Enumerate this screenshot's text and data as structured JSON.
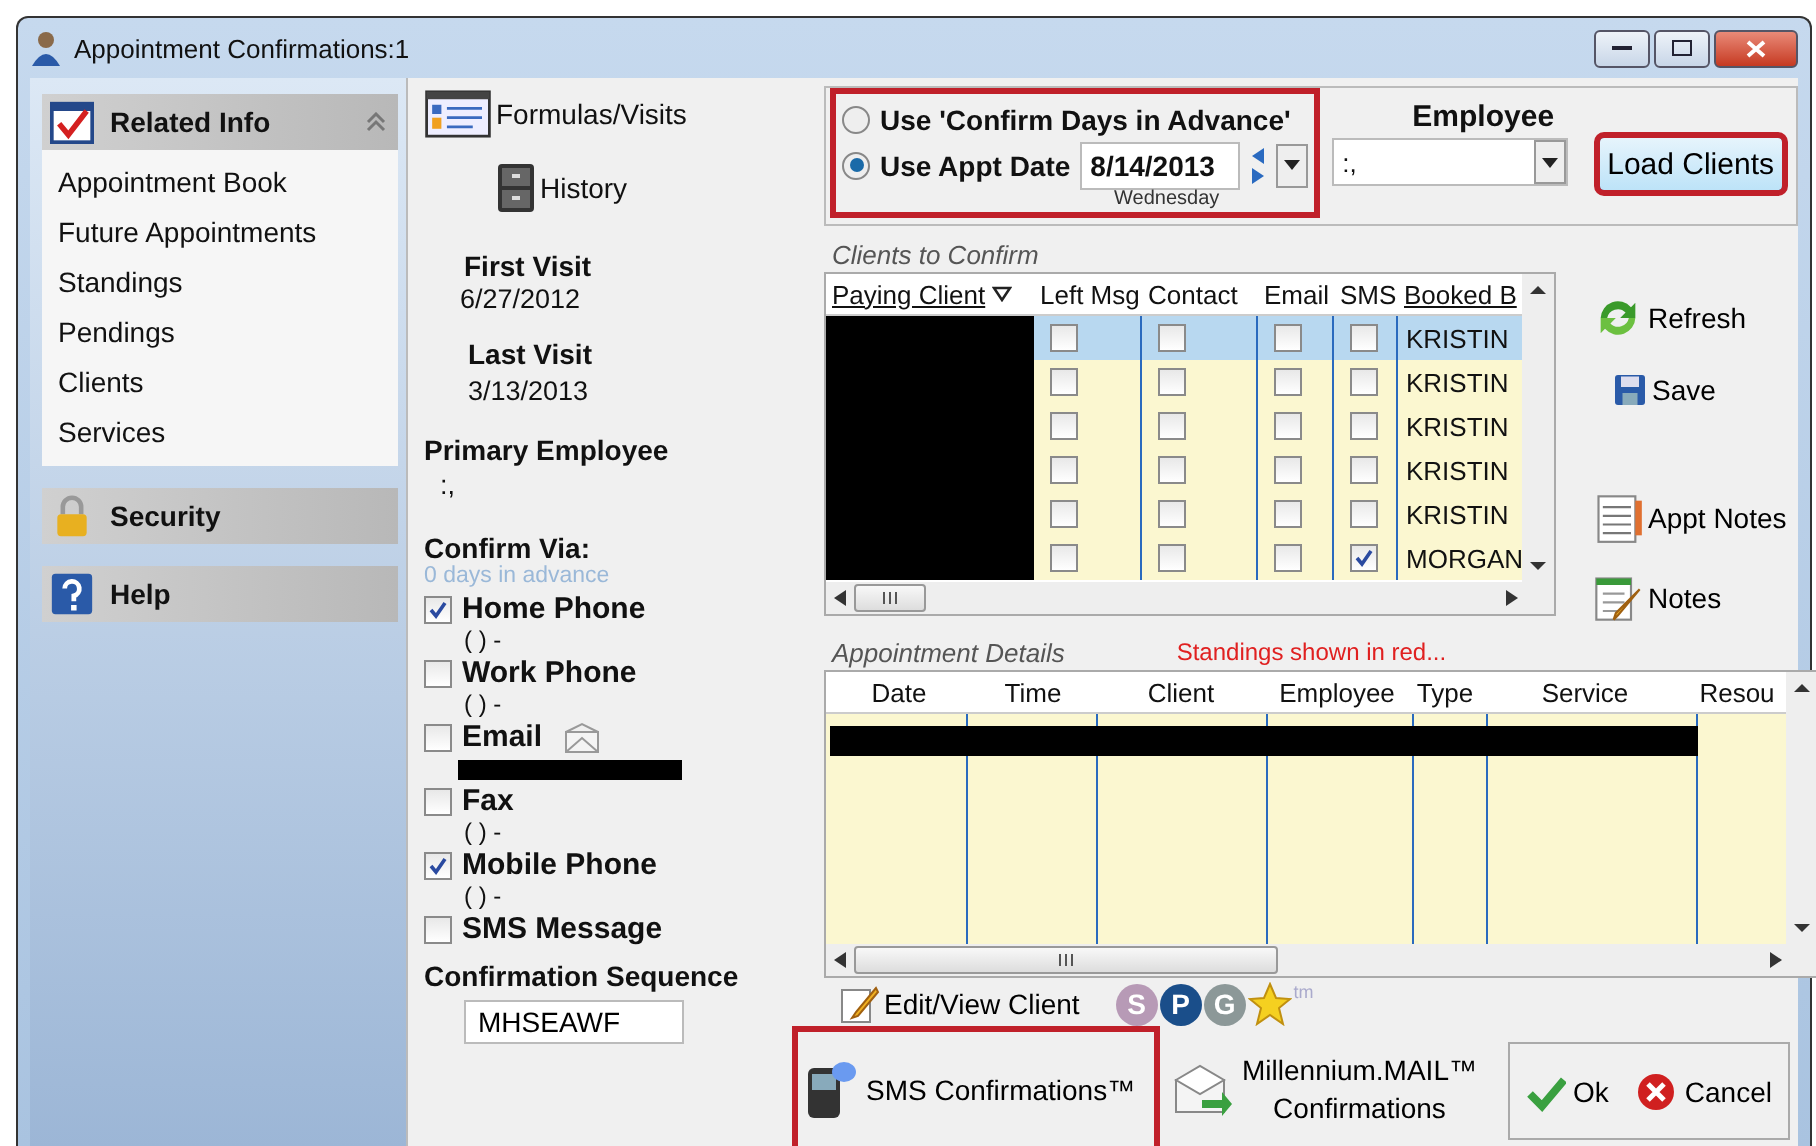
{
  "window": {
    "title": "Appointment Confirmations:1"
  },
  "sidebar": {
    "sections": [
      {
        "title": "Related Info",
        "kind": "related",
        "expanded": true,
        "items": [
          "Appointment Book",
          "Future Appointments",
          "Standings",
          "Pendings",
          "Clients",
          "Services"
        ]
      },
      {
        "title": "Security",
        "kind": "security",
        "expanded": false
      },
      {
        "title": "Help",
        "kind": "help",
        "expanded": false
      }
    ]
  },
  "client_panel": {
    "links": [
      {
        "label": "Formulas/Visits",
        "kind": "formulas"
      },
      {
        "label": "History",
        "kind": "history"
      }
    ],
    "first_visit": {
      "label": "First Visit",
      "value": "6/27/2012"
    },
    "last_visit": {
      "label": "Last Visit",
      "value": "3/13/2013"
    },
    "primary_employee": {
      "label": "Primary Employee",
      "value": ":,"
    },
    "confirm_via": {
      "label": "Confirm Via:",
      "hint": "0 days in advance",
      "options": [
        {
          "label": "Home Phone",
          "kind": "phone",
          "checked": true,
          "detail": "(   ) -"
        },
        {
          "label": "Work Phone",
          "kind": "phone",
          "checked": false,
          "detail": "(   ) -"
        },
        {
          "label": "Email",
          "kind": "email",
          "checked": false
        },
        {
          "label": "Fax",
          "kind": "phone",
          "checked": false,
          "detail": "(   ) -"
        },
        {
          "label": "Mobile Phone",
          "kind": "phone",
          "checked": true,
          "detail": "(   ) -"
        },
        {
          "label": "SMS Message",
          "kind": "plain",
          "checked": false
        }
      ]
    },
    "sequence": {
      "label": "Confirmation Sequence",
      "value": "MHSEAWF"
    }
  },
  "date_mode": {
    "highlighted": true,
    "options": [
      {
        "label": "Use 'Confirm Days in Advance'",
        "selected": false
      },
      {
        "label": "Use Appt Date",
        "selected": true
      }
    ],
    "date": "8/14/2013",
    "weekday": "Wednesday"
  },
  "employee": {
    "label": "Employee",
    "value": ":,"
  },
  "load_button": {
    "label": "Load Clients",
    "highlighted": true
  },
  "clients": {
    "title": "Clients to Confirm",
    "columns": [
      "Paying Client",
      "Left Msg",
      "Contact",
      "Email",
      "SMS",
      "Booked B"
    ],
    "rows": [
      {
        "selected": true,
        "left_msg": false,
        "contacted": false,
        "email": false,
        "sms": false,
        "booked_by": "KRISTIN"
      },
      {
        "selected": false,
        "left_msg": false,
        "contacted": false,
        "email": false,
        "sms": false,
        "booked_by": "KRISTIN"
      },
      {
        "selected": false,
        "left_msg": false,
        "contacted": false,
        "email": false,
        "sms": false,
        "booked_by": "KRISTIN"
      },
      {
        "selected": false,
        "left_msg": false,
        "contacted": false,
        "email": false,
        "sms": false,
        "booked_by": "KRISTIN"
      },
      {
        "selected": false,
        "left_msg": false,
        "contacted": false,
        "email": false,
        "sms": false,
        "booked_by": "KRISTIN"
      },
      {
        "selected": false,
        "left_msg": false,
        "contacted": false,
        "email": false,
        "sms": true,
        "booked_by": "MORGAN"
      }
    ]
  },
  "actions": [
    {
      "label": "Refresh",
      "kind": "refresh"
    },
    {
      "label": "Save",
      "kind": "save"
    },
    {
      "label": "Appt Notes",
      "kind": "appt-notes"
    },
    {
      "label": "Notes",
      "kind": "notes"
    }
  ],
  "appointments": {
    "title": "Appointment Details",
    "note": "Standings shown in red...",
    "columns": [
      "Date",
      "Time",
      "Client",
      "Employee",
      "Type",
      "Service",
      "Resou"
    ]
  },
  "tools": {
    "edit_client": "Edit/View Client",
    "badges": [
      {
        "label": "S",
        "color": "#b79ab6"
      },
      {
        "label": "P",
        "color": "#1a4e8a"
      },
      {
        "label": "G",
        "color": "#8c9898"
      }
    ],
    "trademark": "tm"
  },
  "footer": {
    "sms": {
      "label": "SMS Confirmations™",
      "highlighted": true
    },
    "mail": {
      "lines": [
        "Millennium.MAIL™",
        "Confirmations"
      ]
    },
    "ok": "Ok",
    "cancel": "Cancel"
  }
}
